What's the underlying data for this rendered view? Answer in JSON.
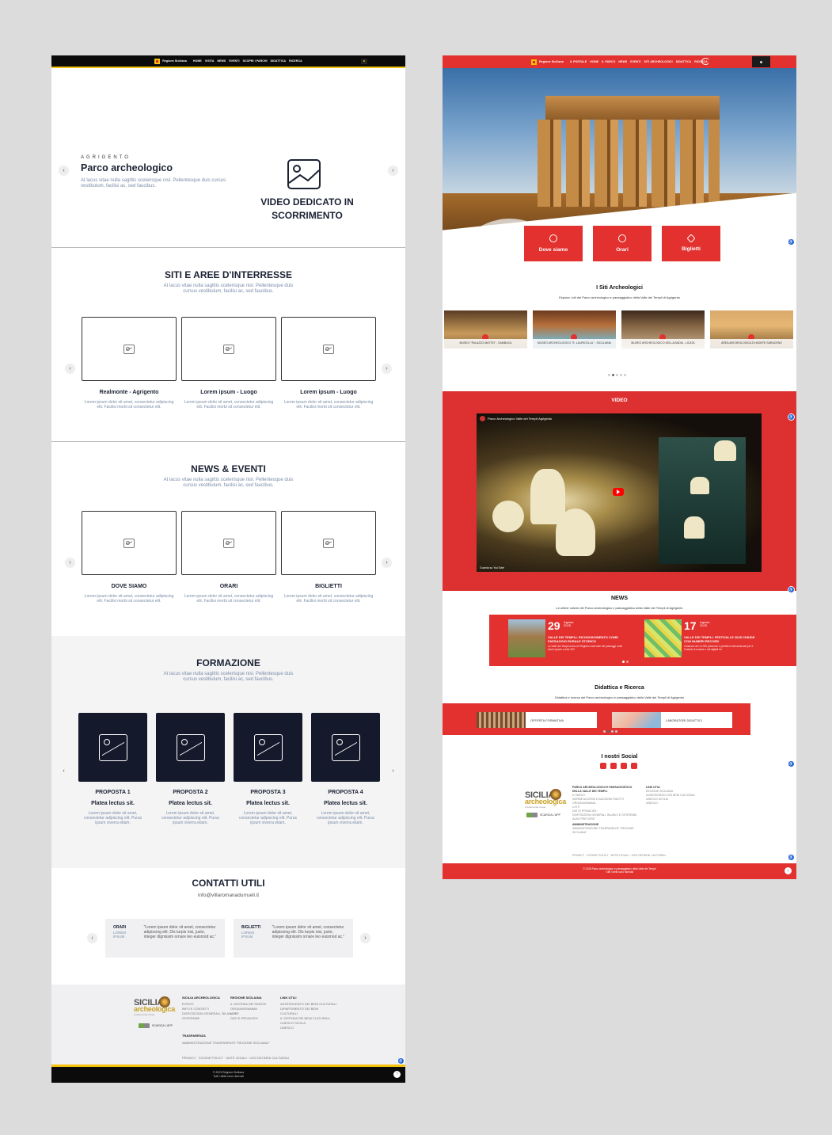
{
  "wireframe": {
    "nav": {
      "brand": "Regione Siciliana",
      "menu": [
        "HOME",
        "VISITA",
        "NEWS",
        "EVENTI",
        "SCOPRI I PARCHI",
        "DIDATTICA",
        "RICERCA"
      ]
    },
    "hero": {
      "kicker": "AGRIGENTO",
      "title": "Parco archeologico",
      "text": "At lacus vitae nulla sagittis scelerisque nisl. Pellentesque duis cursus vestibulum, facilisi ac, sed faucibus.",
      "video_title": "VIDEO DEDICATO IN SCORRIMENTO"
    },
    "siti": {
      "title": "SITI E AREE D'INTERRESSE",
      "text": "At lacus vitae nulla sagittis scelerisque nisl. Pellentesque duis cursus vestibulum, facilisi ac, sed faucibus.",
      "cards": [
        {
          "title": "Realmonte - Agrigento",
          "text": "Lorem ipsum dolor sit amet, consectetur adipiscing elit. Facilisi morbi sit consectetur elit."
        },
        {
          "title": "Lorem ipsum - Luogo",
          "text": "Lorem ipsum dolor sit amet, consectetur adipiscing elit. Facilisi morbi sit consectetur elit."
        },
        {
          "title": "Lorem ipsum - Luogo",
          "text": "Lorem ipsum dolor sit amet, consectetur adipiscing elit. Facilisi morbi sit consectetur elit."
        }
      ]
    },
    "news": {
      "title": "NEWS & EVENTI",
      "text": "At lacus vitae nulla sagittis scelerisque nisl. Pellentesque duis cursus vestibulum, facilisi ac, sed faucibus.",
      "cards": [
        {
          "title": "DOVE SIAMO",
          "text": "Lorem ipsum dolor sit amet, consectetur adipiscing elit. Facilisi morbi sit consectetur elit."
        },
        {
          "title": "ORARI",
          "text": "Lorem ipsum dolor sit amet, consectetur adipiscing elit. Facilisi morbi sit consectetur elit."
        },
        {
          "title": "BIGLIETTI",
          "text": "Lorem ipsum dolor sit amet, consectetur adipiscing elit. Facilisi morbi sit consectetur elit."
        }
      ]
    },
    "formazione": {
      "title": "FORMAZIONE",
      "text": "At lacus vitae nulla sagittis scelerisque nisl. Pellentesque duis cursus vestibulum, facilisi ac, sed faucibus.",
      "cards": [
        {
          "label": "PROPOSTA 1",
          "title": "Platea lectus sit.",
          "text": "Lorem ipsum dolor sit amet, consectetur adipiscing elit. Purus ipsum viverra etiam."
        },
        {
          "label": "PROPOSTA 2",
          "title": "Platea lectus sit.",
          "text": "Lorem ipsum dolor sit amet, consectetur adipiscing elit. Purus ipsum viverra etiam."
        },
        {
          "label": "PROPOSTA 3",
          "title": "Platea lectus sit.",
          "text": "Lorem ipsum dolor sit amet, consectetur adipiscing elit. Purus ipsum viverra etiam."
        },
        {
          "label": "PROPOSTA 4",
          "title": "Platea lectus sit.",
          "text": "Lorem ipsum dolor sit amet, consectetur adipiscing elit. Purus ipsum viverra etiam."
        }
      ]
    },
    "contatti": {
      "title": "CONTATTI UTILI",
      "email": "info@villaromanadurrueli.it",
      "cards": [
        {
          "label": "ORARI",
          "sub": "LOREM IPSUM",
          "quote": "\"Lorem ipsum dolor sit amet, consectetur adipiscing elit. Dis turpis nisi, justo, integer dignissim ornare leo euismod ac.\""
        },
        {
          "label": "BIGLIETTI",
          "sub": "LOREM IPSUM",
          "quote": "\"Lorem ipsum dolor sit amet, consectetur adipiscing elit. Dis turpis nisi, justo, integer dignissim ornare leo euismod ac.\""
        }
      ]
    },
    "footer": {
      "logo_main": "SICILIA",
      "logo_sub": "archeologica",
      "logo_tag": "il sistema dei musei",
      "app_label": "SCARICA L'APP",
      "col1_title": "SICILIA ARCHEOLOGICA",
      "col1_items": [
        "EVENTI",
        "INFO E CONTATTI",
        "DISPOSIZIONI GENERALI, BILANCI E",
        "OSTERNNE"
      ],
      "col2_title": "REGIONE SICILIANA",
      "col2_items": [
        "IL SISTEMA DEI PARCHI",
        "ORGANIGRAMMA",
        "U.R.P.",
        "DATI E PRIVACIES"
      ],
      "col3_title": "LINK UTILI",
      "col3_items": [
        "ASSESSORATO DEI BENI CULTURALI",
        "DIPARTIMENTO DEI BENI",
        "CULTURALI",
        "IL SISTEMA DEI BENI CULTURALI",
        "UNESCO SICILIA",
        "UNESCO"
      ],
      "trasp_title": "TRASPARENZA",
      "trasp_item": "AMMINISTRAZIONE TRASPARENTE \"REGIONE SICILIANA\"",
      "legal": "PRIVACY · COOKIE POLICY · NOTE LEGALI · USO DEI BENI CULTURALI",
      "copyright": "© 2023 Regione Siciliana",
      "rights": "Tutti i diritti sono riservati"
    }
  },
  "design": {
    "nav": {
      "brand": "Regione Siciliana",
      "menu": [
        "IL PORTALE",
        "HOME",
        "IL PARCO",
        "NEWS",
        "EVENTI",
        "SITI ARCHEOLOGICI",
        "DIDATTICA",
        "RICERCA"
      ]
    },
    "quick": [
      {
        "label": "Dove siamo",
        "icon": "location-pin-icon"
      },
      {
        "label": "Orari",
        "icon": "clock-icon"
      },
      {
        "label": "Biglietti",
        "icon": "ticket-icon"
      }
    ],
    "siti": {
      "title": "I Siti Archeologici",
      "sub": "Esplora i siti del Parco archeologico e paesaggistico della Valle dei Templi di Agrigento",
      "items": [
        "MUSEO \"PALAZZO MATTEI\" - SAMBUCA",
        "MUSEO ARCHEOLOGICO \"E. LAURICELLA\" - SICULIANA",
        "MUSEO ARCHEOLOGICO DELLA BADIA - LICATA",
        "AREA ARCHEOLOGICA DI MONTE SARACENO"
      ]
    },
    "video": {
      "title": "VIDEO",
      "player_title": "Parco Archeologico Valle dei Templi Agrigento",
      "watch_on": "Guarda su  YouTube"
    },
    "news": {
      "title": "NEWS",
      "sub": "Le ultime notizie del Parco archeologico e paesaggistico della Valle dei Templi di Agrigento",
      "items": [
        {
          "day": "29",
          "month": "Agosto",
          "year": "2025",
          "title": "VALLE DEI TEMPLI: RICONOSCIMENTO COME PAESAGGIO RURALE STORICO",
          "text": "La Valle dei Templi entra nel Registro nazionale dei paesaggi rurali storici grazie a oltre 300"
        },
        {
          "day": "17",
          "month": "Agosto",
          "year": "2025",
          "title": "VALLE DEI TEMPLI: FESTIVALLE 2025 CHIUDE CON NUMERI RECORD",
          "text": "Il bilancio del 12.000 presenze e pubblico internazionale per il Festival di musica e arti digitali ed"
        }
      ]
    },
    "didattica": {
      "title": "Didattica e Ricerca",
      "sub": "Didattica e ricerca del Parco archeologico e paesaggistico della Valle dei Templi di Agrigento",
      "items": [
        "OFFERTA FORMATIVA",
        "LABORATORI DIDATTICI"
      ]
    },
    "social": {
      "title": "I nostri Social",
      "icons": [
        "twitter-icon",
        "facebook-icon",
        "instagram-icon",
        "youtube-icon"
      ]
    },
    "footer": {
      "logo_main": "SICILIA",
      "logo_sub": "archeologica",
      "logo_tag": "il sistema dei musei",
      "app_label": "SCARICA L'APP",
      "col1_title": "PARCO ARCHEOLOGICO E PAESAGGISTICO DELLA VALLE DEI TEMPLI",
      "col1_items": [
        "IL PARCO",
        "NORME ACCESSI E ADOZIONI RIDOTTI",
        "ORGANIGRAMMA",
        "U.R.P.",
        "DATI E PRIVACIES",
        "DISPOSIZIONI GENERALI, BILANCI E OSTERNNE",
        "ALBO PRETORIO"
      ],
      "col1b_title": "AMMINISTRAZIONE",
      "col1b_item": "AMMINISTRAZIONE TRASPARENTE \"REGIONE SICILIANA\"",
      "col2_title": "LINK UTILI",
      "col2_items": [
        "REGIONE SICILIANA",
        "ASSESSORATO DEI BENI CULTURALI",
        "UNESCO SICILIA",
        "UNESCO"
      ],
      "legal": "PRIVACY · COOKIE POLICY · NOTE LEGALI · USO DEI BENI CULTURALI",
      "copyright": "© 2025 Parco archeologico e paesaggistico della Valle dei Templi",
      "rights": "Tutti i diritti sono riservati"
    }
  },
  "colors": {
    "wireframe_dark": "#141a2b",
    "accent_yellow": "#f4c20d",
    "brand_red": "#e2312e",
    "muted_text": "#7a8da8"
  }
}
